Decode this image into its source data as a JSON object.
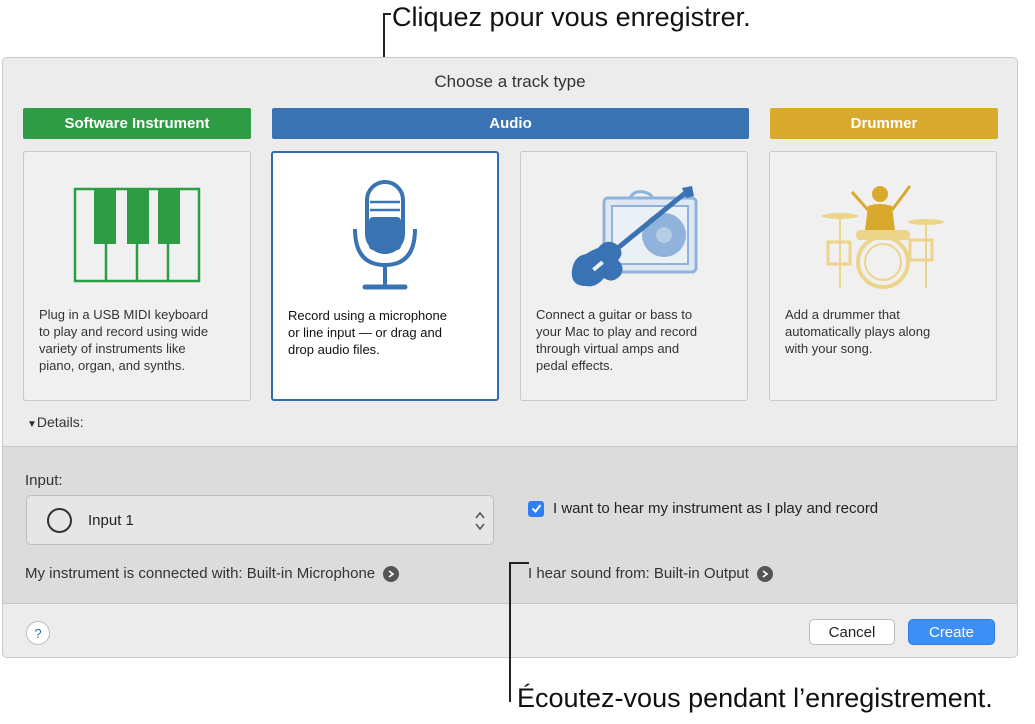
{
  "callouts": {
    "top": "Cliquez pour vous enregistrer.",
    "bottom": "Écoutez-vous pendant l’enregistrement."
  },
  "dialog": {
    "title": "Choose a track type"
  },
  "tabs": [
    {
      "label": "Software Instrument",
      "color": "#2e9b45"
    },
    {
      "label": "Audio",
      "color": "#3a73b3"
    },
    {
      "label": "Drummer",
      "color": "#d8a92c"
    }
  ],
  "cards": [
    {
      "icon": "piano-keys-icon",
      "description": "Plug in a USB MIDI keyboard\nto play and record using wide\nvariety of instruments like\npiano, organ, and synths."
    },
    {
      "icon": "microphone-icon",
      "description": "Record using a microphone\nor line input — or drag and\ndrop audio files.",
      "selected": true
    },
    {
      "icon": "guitar-amp-icon",
      "description": "Connect a guitar or bass to\nyour Mac to play and record\nthrough virtual amps and\npedal effects."
    },
    {
      "icon": "drummer-icon",
      "description": "Add a drummer that\nautomatically plays along\nwith your song."
    }
  ],
  "details": {
    "toggle_label": "Details:",
    "input_label": "Input:",
    "input_value": "Input 1",
    "connected_with": "My instrument is connected with: Built-in Microphone",
    "monitor_label": "I want to hear my instrument as I play and record",
    "monitor_checked": true,
    "hear_sound_from": "I hear sound from: Built-in Output"
  },
  "footer": {
    "help_label": "?",
    "cancel_label": "Cancel",
    "create_label": "Create"
  },
  "colors": {
    "accent": "#3d8ff5",
    "green": "#2e9b45",
    "blue": "#3a73b3",
    "gold": "#d8a92c",
    "light_blue": "#8fb3da",
    "light_gold": "#ecd48a"
  }
}
